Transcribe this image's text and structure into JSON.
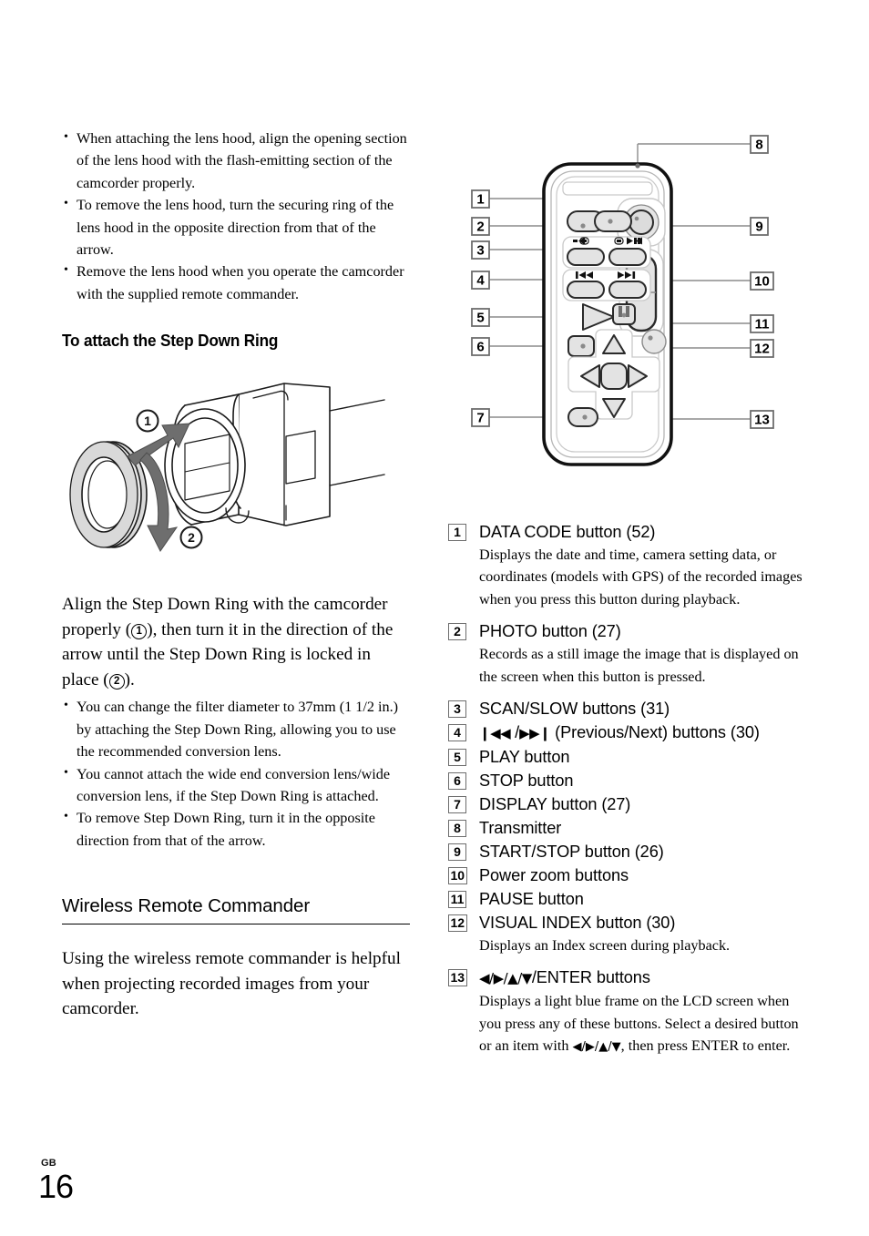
{
  "left_column": {
    "top_bullets": [
      "When attaching the lens hood, align the opening section of the lens hood with the flash-emitting section of the camcorder properly.",
      "To remove the lens hood, turn the securing ring of the lens hood in the opposite direction from that of the arrow.",
      "Remove the lens hood when you operate the camcorder with the supplied remote commander."
    ],
    "heading_step_down": "To attach the Step Down Ring",
    "step_down_paragraph_parts": {
      "a": "Align the Step Down Ring with the camcorder properly (",
      "n1": "1",
      "b": "), then turn it in the direction of the arrow until the Step Down Ring is locked in place (",
      "n2": "2",
      "c": ")."
    },
    "step_down_bullets": [
      "You can change the filter diameter to 37mm (1 1/2 in.) by attaching the Step Down Ring, allowing you to use the recommended conversion lens.",
      "You cannot attach the wide end conversion lens/wide conversion lens, if the Step Down Ring is attached.",
      "To remove Step Down Ring, turn it in the opposite direction from that of the arrow."
    ],
    "heading_remote": "Wireless Remote Commander",
    "remote_paragraph": "Using the wireless remote commander is helpful when projecting recorded images from your camcorder."
  },
  "illustration_lens": {
    "callout_1": "1",
    "callout_2": "2"
  },
  "illustration_remote": {
    "callouts_left": [
      "1",
      "2",
      "3",
      "4",
      "5",
      "6",
      "7"
    ],
    "callouts_right": [
      "8",
      "9",
      "10",
      "11",
      "12",
      "13"
    ],
    "button_glyphs": {
      "slow_reverse": "◀I▣",
      "slow_forward": "▣I▶",
      "previous": "I◀◀",
      "next": "▶▶I"
    }
  },
  "right_column": {
    "items": [
      {
        "num": "1",
        "title": "DATA CODE button (52)",
        "desc": "Displays the date and time, camera setting data, or coordinates (models with GPS) of the recorded images when you press this button during playback."
      },
      {
        "num": "2",
        "title": "PHOTO button (27)",
        "desc": "Records as a still image the image that is displayed on the screen when this button is pressed."
      },
      {
        "num": "3",
        "title": "SCAN/SLOW buttons (31)",
        "desc": ""
      },
      {
        "num": "4",
        "title_prefix": "",
        "glyph_prev": "◀◀",
        "glyph_next": "▶▶",
        "title": "(Previous/Next) buttons (30)",
        "desc": ""
      },
      {
        "num": "5",
        "title": "PLAY button",
        "desc": ""
      },
      {
        "num": "6",
        "title": "STOP button",
        "desc": ""
      },
      {
        "num": "7",
        "title": "DISPLAY button (27)",
        "desc": ""
      },
      {
        "num": "8",
        "title": "Transmitter",
        "desc": ""
      },
      {
        "num": "9",
        "title": "START/STOP button (26)",
        "desc": ""
      },
      {
        "num": "10",
        "title": "Power zoom buttons",
        "desc": ""
      },
      {
        "num": "11",
        "title": "PAUSE button",
        "desc": ""
      },
      {
        "num": "12",
        "title": "VISUAL INDEX button (30)",
        "desc": "Displays an Index screen during playback."
      },
      {
        "num": "13",
        "title": "/ENTER buttons",
        "glyphs": "◀/▶/▲/▼",
        "desc_a": "Displays a light blue frame on the LCD screen when you press any of these buttons. Select a desired button or an item with ",
        "desc_glyphs": "◀/▶/▲/▼",
        "desc_b": ", then press ENTER to enter."
      }
    ]
  },
  "footer": {
    "region": "GB",
    "page": "16"
  },
  "colors": {
    "ink": "#000000",
    "leader_line": "#808080",
    "button_fill": "#e3e3e3",
    "button_fill_light": "#ebebeb",
    "body_fill": "#ffffff",
    "ring_fill": "#d9d9d9",
    "arrow_fill": "#6e6e6e"
  }
}
